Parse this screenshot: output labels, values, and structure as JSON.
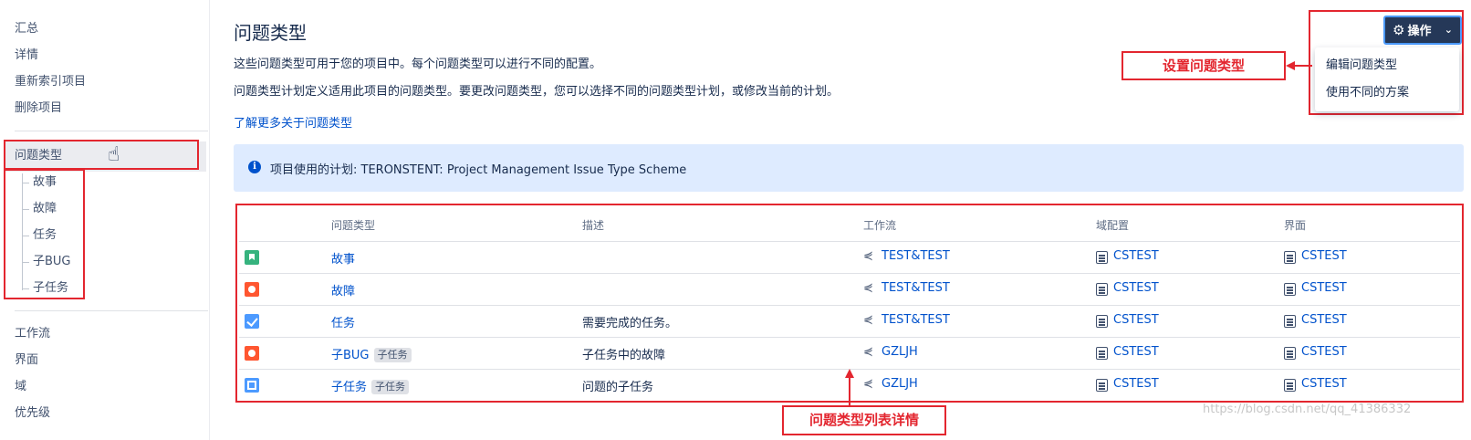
{
  "sidebar": {
    "top_items": [
      "汇总",
      "详情",
      "重新索引项目",
      "删除项目"
    ],
    "active_item": "问题类型",
    "sub_items": [
      "故事",
      "故障",
      "任务",
      "子BUG",
      "子任务"
    ],
    "bottom_items": [
      "工作流",
      "界面",
      "域",
      "优先级"
    ]
  },
  "header": {
    "title": "问题类型",
    "desc1": "这些问题类型可用于您的项目中。每个问题类型可以进行不同的配置。",
    "desc2": "问题类型计划定义适用此项目的问题类型。要更改问题类型，您可以选择不同的问题类型计划，或修改当前的计划。",
    "learn_more": "了解更多关于问题类型"
  },
  "info": {
    "text": "项目使用的计划: TERONSTENT: Project Management Issue Type Scheme"
  },
  "actions": {
    "button_label": "操作",
    "menu": [
      "编辑问题类型",
      "使用不同的方案"
    ]
  },
  "annotations": {
    "settings": "设置问题类型",
    "list": "问题类型列表详情"
  },
  "table": {
    "headers": [
      "问题类型",
      "描述",
      "工作流",
      "域配置",
      "界面"
    ],
    "rows": [
      {
        "icon": "story-icon",
        "name": "故事",
        "tag": "",
        "desc": "",
        "workflow": "TEST&TEST",
        "field_config": "CSTEST",
        "screen": "CSTEST"
      },
      {
        "icon": "bug-icon",
        "name": "故障",
        "tag": "",
        "desc": "",
        "workflow": "TEST&TEST",
        "field_config": "CSTEST",
        "screen": "CSTEST"
      },
      {
        "icon": "task-icon",
        "name": "任务",
        "tag": "",
        "desc": "需要完成的任务。",
        "workflow": "TEST&TEST",
        "field_config": "CSTEST",
        "screen": "CSTEST"
      },
      {
        "icon": "bug-icon",
        "name": "子BUG",
        "tag": "子任务",
        "desc": "子任务中的故障",
        "workflow": "GZLJH",
        "field_config": "CSTEST",
        "screen": "CSTEST"
      },
      {
        "icon": "subtask-icon",
        "name": "子任务",
        "tag": "子任务",
        "desc": "问题的子任务",
        "workflow": "GZLJH",
        "field_config": "CSTEST",
        "screen": "CSTEST"
      }
    ]
  },
  "watermark": "https://blog.csdn.net/qq_41386332",
  "colors": {
    "accent": "#0052cc",
    "annotation_red": "#e3262f",
    "info_bg": "#deebff",
    "button_bg": "#253858"
  }
}
